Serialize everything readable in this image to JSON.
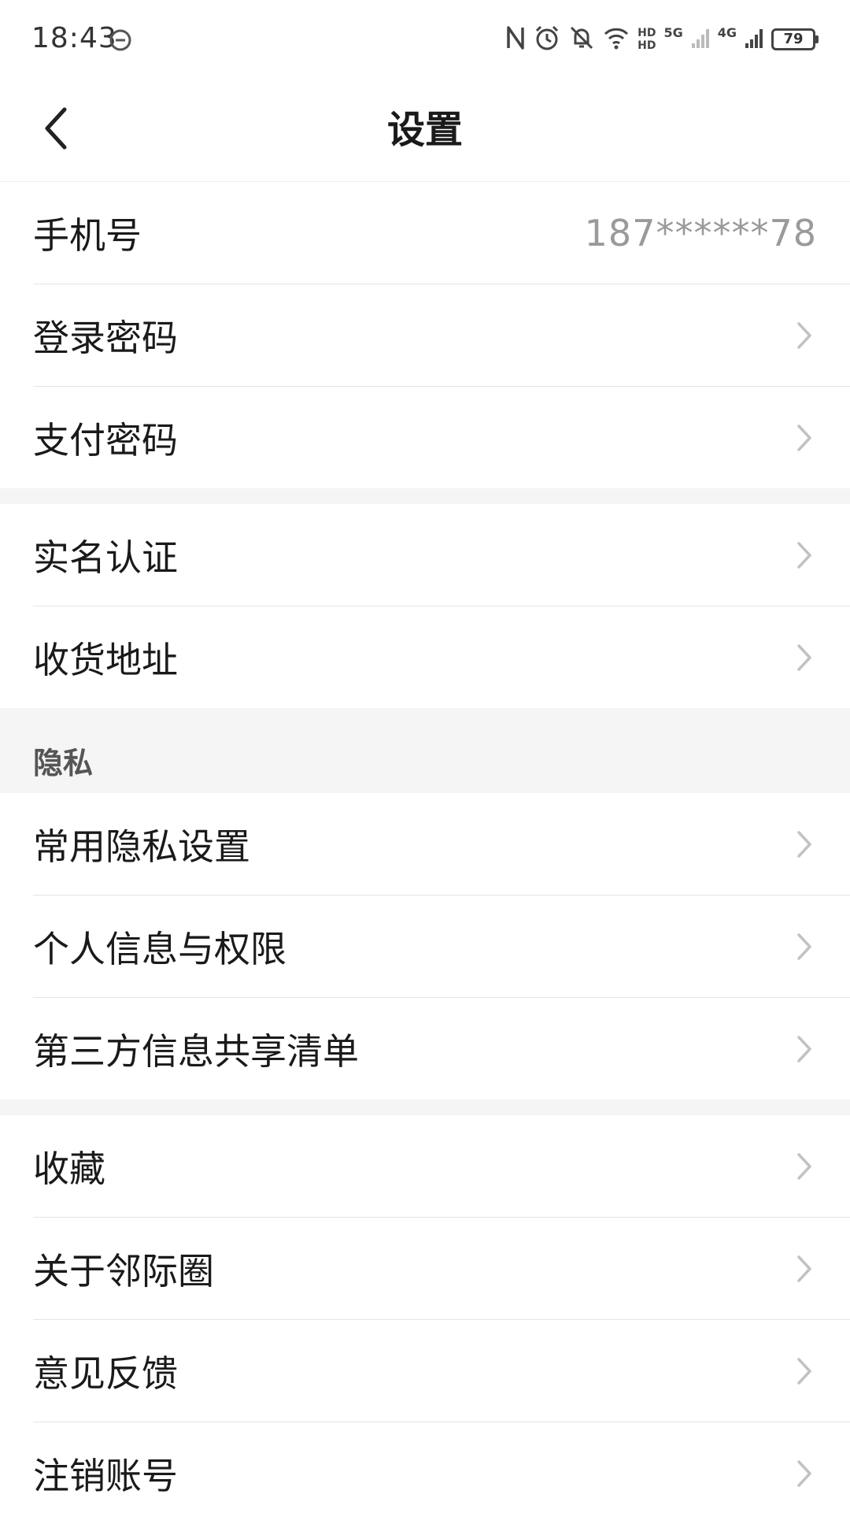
{
  "status_bar": {
    "time": "18:43",
    "hd_top": "HD",
    "hd_bottom": "HD",
    "net_5g": "5G",
    "net_4g": "4G",
    "battery": "79"
  },
  "header": {
    "title": "设置"
  },
  "account_group": [
    {
      "label": "手机号",
      "value": "187******78"
    },
    {
      "label": "登录密码"
    },
    {
      "label": "支付密码"
    }
  ],
  "identity_group": [
    {
      "label": "实名认证"
    },
    {
      "label": "收货地址"
    }
  ],
  "privacy_section": {
    "header": "隐私",
    "items": [
      {
        "label": "常用隐私设置"
      },
      {
        "label": "个人信息与权限"
      },
      {
        "label": "第三方信息共享清单"
      }
    ]
  },
  "misc_group": [
    {
      "label": "收藏"
    },
    {
      "label": "关于邻际圈"
    },
    {
      "label": "意见反馈"
    },
    {
      "label": "注销账号"
    }
  ],
  "icons": {
    "back": "chevron-left-icon",
    "row_arrow": "chevron-right-icon"
  },
  "colors": {
    "background": "#ffffff",
    "divider": "#e4e4e4",
    "section_bg": "#f5f5f5",
    "value_text": "#9a9a9a",
    "chevron": "#c2c2c2"
  }
}
